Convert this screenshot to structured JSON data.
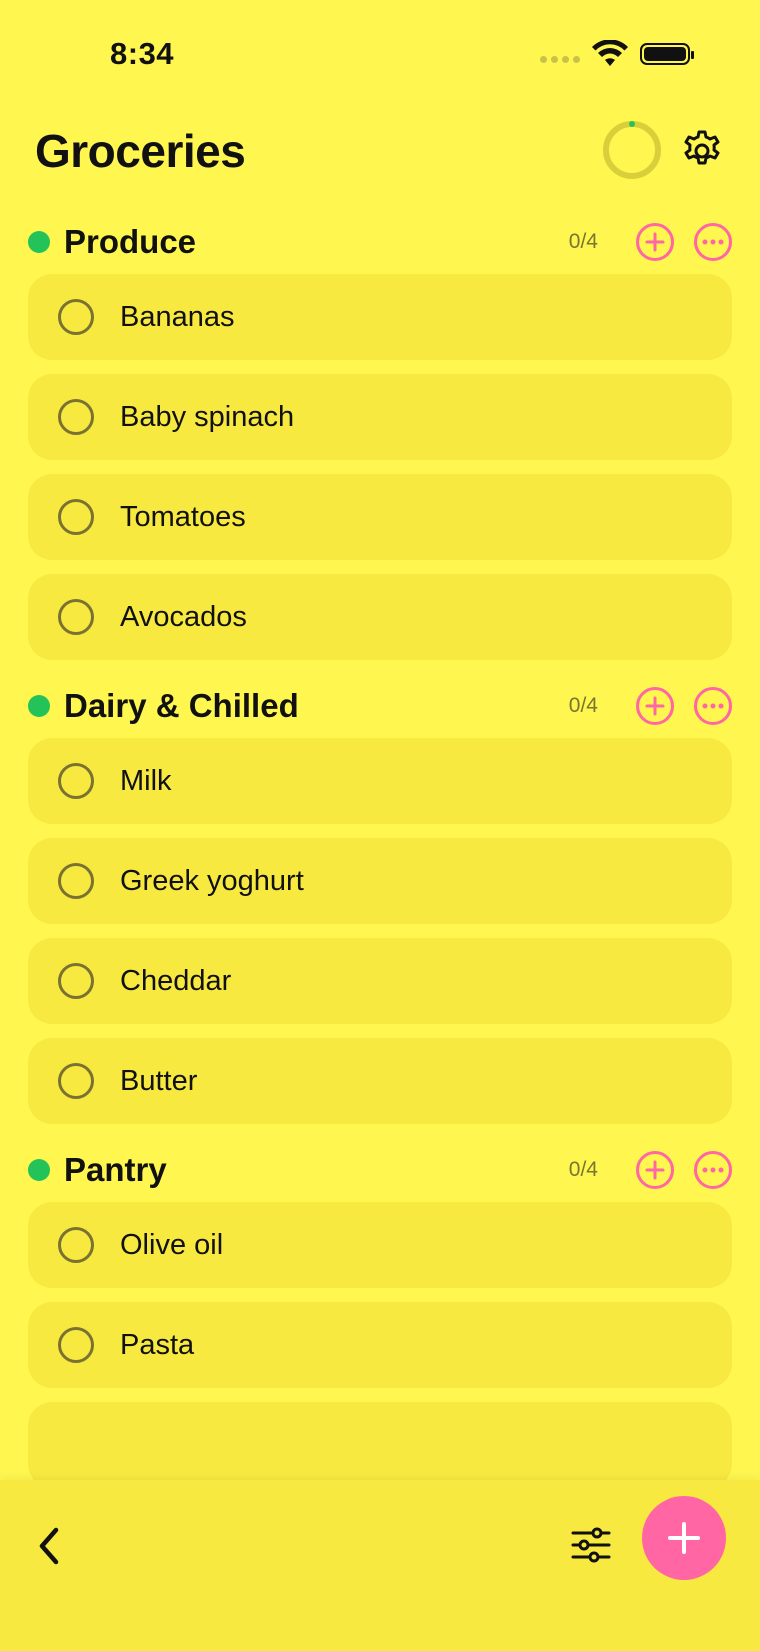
{
  "status_bar": {
    "time": "8:34"
  },
  "header": {
    "title": "Groceries",
    "progress_fraction": 0
  },
  "colors": {
    "background": "#FFF650",
    "card": "#F8E940",
    "accent_pink": "#FF66A3",
    "section_dot_green": "#23C35A"
  },
  "icons": {
    "settings": "gear-icon",
    "back": "chevron-left-icon",
    "filter": "sliders-icon",
    "add": "plus-icon",
    "more": "ellipsis-icon"
  },
  "sections": [
    {
      "title": "Produce",
      "count": "0/4",
      "items": [
        "Bananas",
        "Baby spinach",
        "Tomatoes",
        "Avocados"
      ]
    },
    {
      "title": "Dairy & Chilled",
      "count": "0/4",
      "items": [
        "Milk",
        "Greek yoghurt",
        "Cheddar",
        "Butter"
      ]
    },
    {
      "title": "Pantry",
      "count": "0/4",
      "items": [
        "Olive oil",
        "Pasta"
      ]
    }
  ]
}
